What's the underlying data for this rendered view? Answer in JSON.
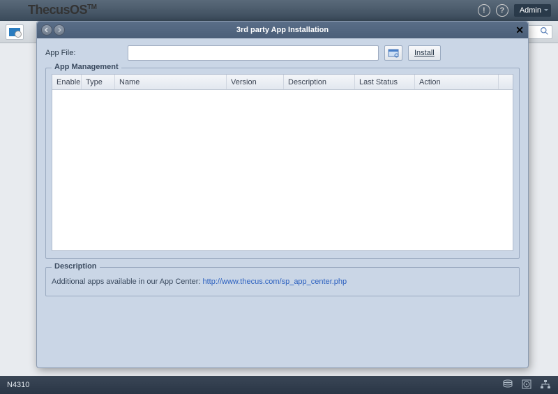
{
  "brand": {
    "name": "ThecusOS",
    "tm": "TM"
  },
  "top": {
    "admin_label": "Admin"
  },
  "footer": {
    "model": "N4310"
  },
  "dialog": {
    "title": "3rd party App Installation",
    "file_label": "App File:",
    "install_label": "Install",
    "app_management": {
      "legend": "App Management",
      "columns": {
        "enable": "Enable",
        "type": "Type",
        "name": "Name",
        "version": "Version",
        "description": "Description",
        "last_status": "Last Status",
        "action": "Action"
      },
      "rows": []
    },
    "description": {
      "legend": "Description",
      "text": "Additional apps available in our App Center: ",
      "link_text": "http://www.thecus.com/sp_app_center.php"
    }
  }
}
